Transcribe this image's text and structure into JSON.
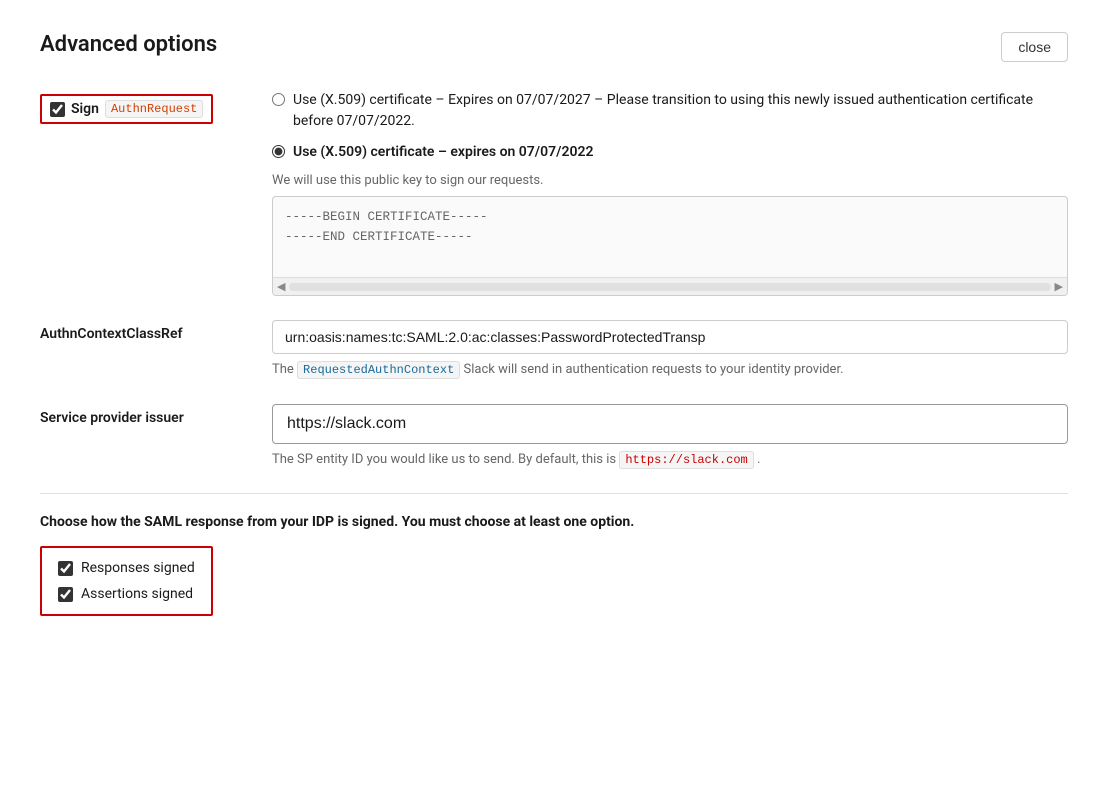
{
  "page": {
    "title": "Advanced options",
    "close_button": "close"
  },
  "sign_authn": {
    "checkbox_checked": true,
    "label": "Sign",
    "code_tag": "AuthnRequest"
  },
  "certificates": {
    "option1": {
      "label": "Use (X.509) certificate – Expires on 07/07/2027 – Please transition to using this newly issued authentication certificate before 07/07/2022.",
      "selected": false
    },
    "option2": {
      "label": "Use (X.509) certificate – expires on 07/07/2022",
      "selected": true
    },
    "hint": "We will use this public key to sign our requests.",
    "cert_begin": "-----BEGIN CERTIFICATE-----",
    "cert_end": "-----END CERTIFICATE-----"
  },
  "authn_context": {
    "label": "AuthnContextClassRef",
    "value": "urn:oasis:names:tc:SAML:2.0:ac:classes:PasswordProtectedTransp",
    "hint_prefix": "The",
    "hint_code": "RequestedAuthnContext",
    "hint_suffix": "Slack will send in authentication requests to your identity provider."
  },
  "service_provider": {
    "label": "Service provider issuer",
    "value": "https://slack.com",
    "hint_prefix": "The SP entity ID you would like us to send. By default, this is",
    "hint_code": "https://slack.com",
    "hint_suffix": "."
  },
  "saml_signing": {
    "heading": "Choose how the SAML response from your IDP is signed. You must choose at least one option.",
    "options": [
      {
        "label": "Responses signed",
        "checked": true
      },
      {
        "label": "Assertions signed",
        "checked": true
      }
    ]
  }
}
